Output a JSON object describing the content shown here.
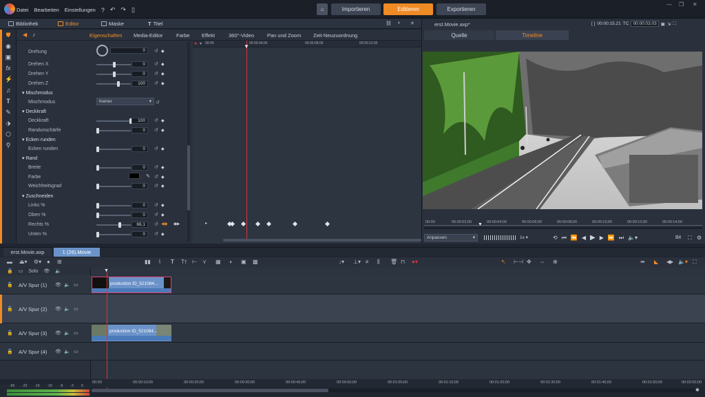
{
  "menu": {
    "file": "Datei",
    "edit": "Bearbeiten",
    "settings": "Einstellungen"
  },
  "topnav": {
    "import": "Importieren",
    "edit": "Editieren",
    "export": "Exportieren"
  },
  "lefttabs": {
    "library": "Bibliothek",
    "editor": "Editor",
    "mask": "Maske",
    "title": "Titel"
  },
  "props_tabs": [
    "Eigenschaften",
    "Media-Editor",
    "Farbe",
    "Effekt",
    "360°-Video",
    "Pan und Zoom",
    "Zeit-Neuzuordnung"
  ],
  "props": {
    "drehung": "Drehung",
    "drehung_val": "0",
    "drehen_x": "Drehen X",
    "drehen_x_val": "0",
    "drehen_y": "Drehen Y",
    "drehen_y_val": "0",
    "drehen_z": "Drehen Z",
    "drehen_z_val": "100",
    "mischmodus_sec": "Mischmodus",
    "mischmodus": "Mischmodus",
    "mischmodus_val": "Keiner",
    "deckkraft_sec": "Deckkraft",
    "deckkraft": "Deckkraft",
    "deckkraft_val": "100",
    "randunschaerfe": "Randunschärfe",
    "randunschaerfe_val": "0",
    "ecken_sec": "Ecken runden",
    "ecken": "Ecken runden",
    "ecken_val": "0",
    "rand_sec": "Rand",
    "breite": "Breite",
    "breite_val": "0",
    "farbe": "Farbe",
    "weichheit": "Weichheitsgrad",
    "weichheit_val": "0",
    "zuschneiden_sec": "Zuschneiden",
    "links": "Links %",
    "links_val": "0",
    "oben": "Oben %",
    "oben_val": "0",
    "rechts": "Rechts %",
    "rechts_val": "66,1",
    "unten": "Unten %",
    "unten_val": "0"
  },
  "kf_ruler": [
    "00:00",
    "00:00:04;00",
    "00:00:08;00",
    "00:00:12;00"
  ],
  "preview": {
    "filename": "erst.Movie.axp*",
    "timecode1": "00:00:15.21",
    "tc_label": "TC",
    "timecode2": "00:00:03.03",
    "source_tab": "Quelle",
    "timeline_tab": "Timeline",
    "fit": "Anpassen",
    "speed": "1x",
    "bit": "Bit"
  },
  "preview_ruler": [
    "00:00",
    "00:00:02;00",
    "00:00:04;00",
    "00:00:06;00",
    "00:00:08;00",
    "00:00:10;00",
    "00:00:12;00",
    "00:00:14;00"
  ],
  "timeline_tabs": [
    "erst.Movie.axp",
    "1 (26).Movie"
  ],
  "solo": "Solo",
  "tracks": [
    "A/V Spur (1)",
    "A/V Spur (2)",
    "A/V Spur (3)",
    "A/V Spur (4)"
  ],
  "clip_label": "production ID_521084...",
  "tl_ruler": [
    "00:00",
    "00:00:10;00",
    "00:00:20;00",
    "00:00:30;00",
    "00:00:40;00",
    "00:00:50;00",
    "00:01:00;00",
    "00:01:10;00",
    "00:01:20;00",
    "00:01:30;00",
    "00:01:40;00",
    "00:01:50;00",
    "00:02:00;00"
  ],
  "meter_scale": [
    "-50",
    "-22",
    "-16",
    "-10",
    "-6",
    "-3",
    "0"
  ],
  "colors": {
    "accent": "#f08a24",
    "bg": "#1f2631",
    "clip": "#6b93c9",
    "playhead": "#e0323a"
  }
}
